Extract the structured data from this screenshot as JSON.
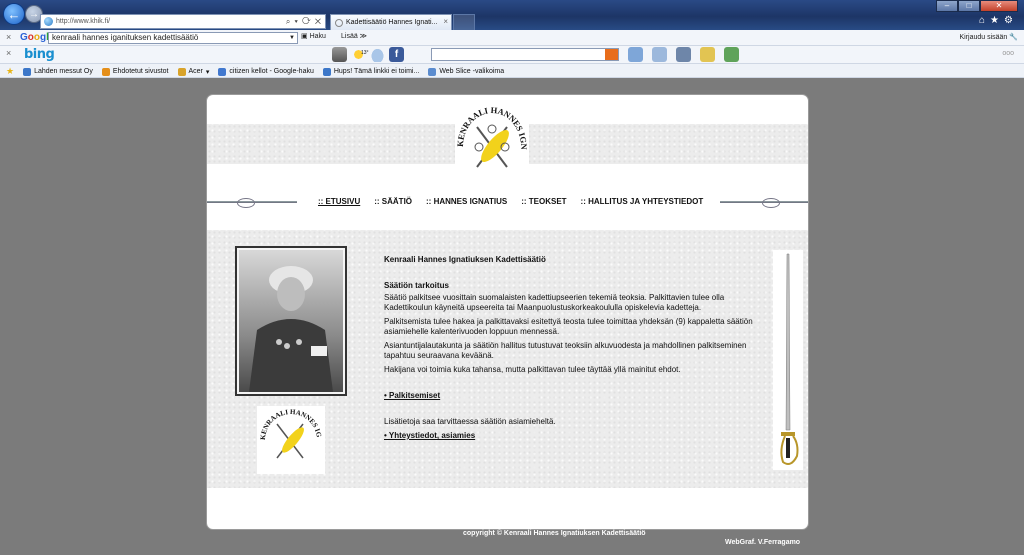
{
  "browser": {
    "address": "http://www.khik.fi/",
    "tab_title": "Kadettisäätiö Hannes Ignati...",
    "toolbar_google": {
      "logo_letters": [
        "G",
        "o",
        "o",
        "g",
        "l",
        "e"
      ],
      "query": "kenraali hannes iganituksen kadettisäätiö",
      "haku_label": "Haku",
      "lisaa_label": "Lisää ≫",
      "signin_label": "Kirjaudu sisään"
    },
    "toolbar_bing": {
      "logo": "bing",
      "weather": "13°",
      "more": "ooo"
    },
    "favorites": [
      {
        "label": "Lahden messut Oy"
      },
      {
        "label": "Ehdotetut sivustot"
      },
      {
        "label": "Acer"
      },
      {
        "label": "citizen kellot - Google-haku"
      },
      {
        "label": "Hups! Tämä linkki ei toimi..."
      },
      {
        "label": "Web Slice -valikoima"
      }
    ],
    "accent_blue": "#1d3566"
  },
  "site": {
    "nav": [
      {
        "label": ":: ETUSIVU",
        "active": true
      },
      {
        "label": ":: SÄÄTIÖ"
      },
      {
        "label": ":: HANNES IGNATIUS"
      },
      {
        "label": ":: TEOKSET"
      },
      {
        "label": ":: HALLITUS JA YHTEYSTIEDOT"
      }
    ],
    "seal_text": "KENRAALI HANNES IGNATIUKSEN KADETTISÄÄTIÖ",
    "content": {
      "title": "Kenraali Hannes Ignatiuksen Kadettisäätiö",
      "purpose_heading": "Säätiön tarkoitus",
      "paragraphs": [
        "Säätiö palkitsee vuosittain suomalaisten kadettiupseerien tekemiä teoksia. Palkittavien tulee olla Kadettikoulun käyneitä upseereita tai Maanpuolustuskorkeakoululla opiskelevia kadetteja.",
        "Palkitsemista tulee hakea ja palkittavaksi esitettyä teosta tulee toimittaa yhdeksän (9) kappaletta säätiön asiamiehelle kalenterivuoden loppuun mennessä.",
        "Asiantuntijalautakunta ja säätiön hallitus tutustuvat teoksiin alkuvuodesta ja mahdollinen palkitseminen tapahtuu seuraavana keväänä.",
        "Hakijana voi toimia kuka tahansa, mutta palkittavan tulee täyttää yllä mainitut ehdot."
      ],
      "link_awards": "• Palkitsemiset",
      "more_info": "Lisätietoja saa tarvittaessa säätiön asiamieheltä.",
      "link_contact": "• Yhteystiedot, asiamies"
    },
    "footer": {
      "copyright": "copyright © Kenraali Hannes Ignatiuksen Kadettisäätiö",
      "credit": "WebGraf. V.Ferragamo"
    }
  }
}
